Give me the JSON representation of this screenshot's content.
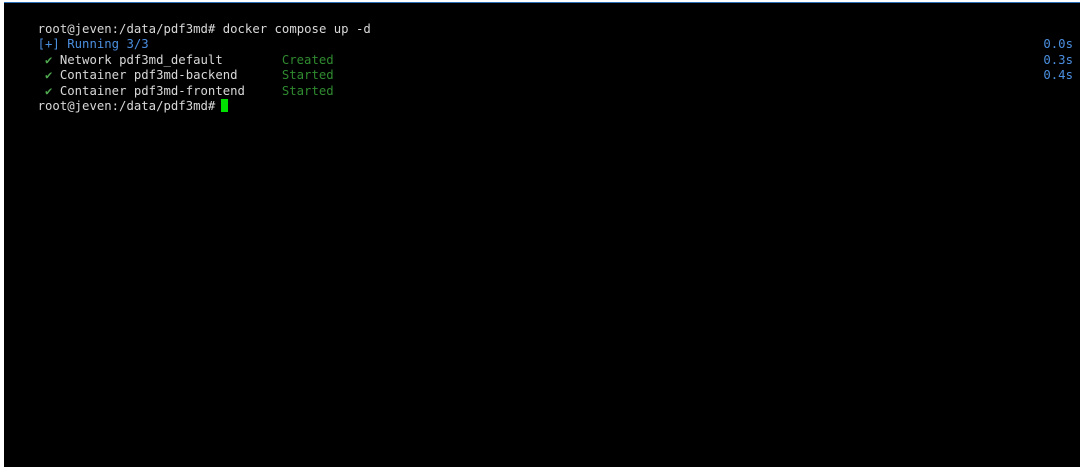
{
  "terminal": {
    "command_line": "root@jeven:/data/pdf3md# docker compose up -d",
    "running_status": "[+] Running 3/3",
    "check_glyph": "✔",
    "resources": [
      {
        "name": "Network pdf3md_default",
        "status": "Created",
        "elapsed": "0.0s"
      },
      {
        "name": "Container pdf3md-backend",
        "status": "Started",
        "elapsed": "0.3s"
      },
      {
        "name": "Container pdf3md-frontend",
        "status": "Started",
        "elapsed": "0.4s"
      }
    ],
    "prompt": "root@jeven:/data/pdf3md#"
  },
  "colors": {
    "background": "#000000",
    "text": "#d8d8d8",
    "info_blue": "#4b8fe0",
    "status_green": "#2f8a2f",
    "cursor_green": "#00e000"
  },
  "icons": {
    "check": "check-icon",
    "cursor": "block-cursor"
  }
}
